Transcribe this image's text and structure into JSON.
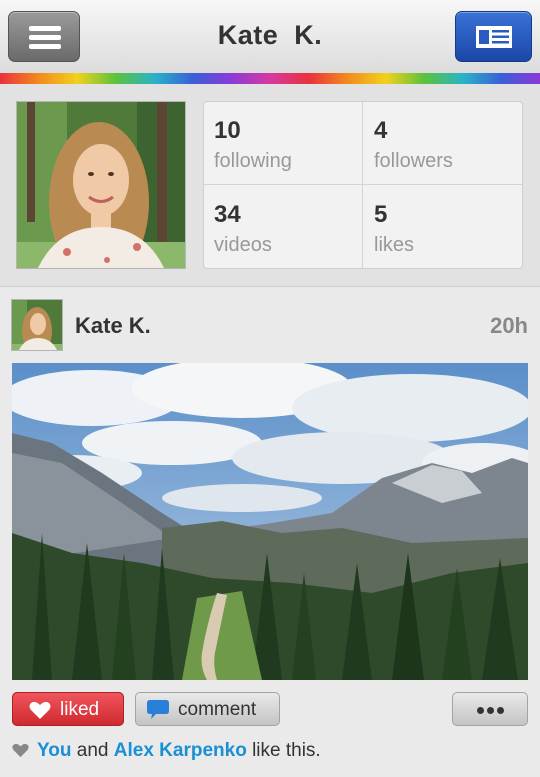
{
  "nav": {
    "title": "Kate  K."
  },
  "profile": {
    "stats": [
      {
        "count": "10",
        "label": "following"
      },
      {
        "count": "4",
        "label": "followers"
      },
      {
        "count": "34",
        "label": "videos"
      },
      {
        "count": "5",
        "label": "likes"
      }
    ]
  },
  "post": {
    "author": "Kate K.",
    "time": "20h",
    "actions": {
      "liked_label": "liked",
      "comment_label": "comment"
    },
    "likes": {
      "user1": "You",
      "conjunction": "and",
      "user2": "Alex Karpenko",
      "suffix": "like this."
    }
  },
  "colors": {
    "liked_red": "#e03c42",
    "link_blue": "#1a8fd6",
    "feed_button_blue": "#2a5bc2"
  },
  "icons": [
    "menu-icon",
    "news-feed-icon",
    "heart-icon",
    "speech-bubble-icon",
    "more-icon",
    "small-heart-icon"
  ]
}
